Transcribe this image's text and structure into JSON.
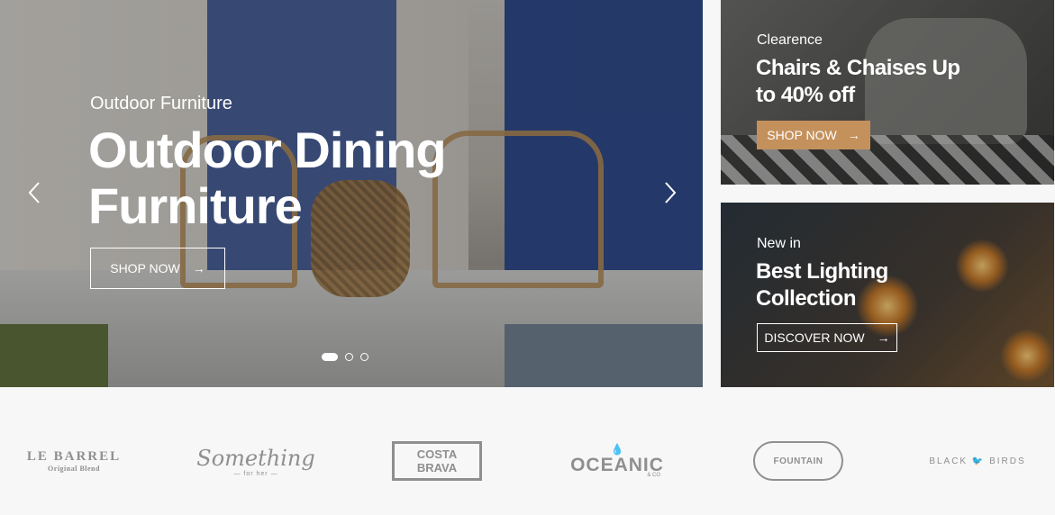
{
  "hero": {
    "subtitle": "Outdoor Furniture",
    "title": "Outdoor Dining Furniture",
    "cta": "SHOP NOW",
    "cta_icon": "arrow-right-icon",
    "prev_icon": "chevron-left-icon",
    "next_icon": "chevron-right-icon",
    "slides_count": 3,
    "active_slide": 1
  },
  "promo1": {
    "kicker": "Clearence",
    "title": "Chairs & Chaises Up to 40% off",
    "cta": "SHOP NOW",
    "cta_color": "#c4915c"
  },
  "promo2": {
    "kicker": "New in",
    "title": "Best Lighting Collection",
    "cta": "DISCOVER NOW"
  },
  "brands": [
    {
      "main": "LE BARREL",
      "sub": "Original Blend"
    },
    {
      "main": "Something",
      "sub": "— for her —"
    },
    {
      "main": "COSTA BRAVA",
      "sub": ""
    },
    {
      "main": "OCEANIC",
      "sub": "& CO"
    },
    {
      "main": "FOUNTAIN",
      "sub": ""
    },
    {
      "main": "BLACK 🐦 BIRDS",
      "sub": ""
    }
  ],
  "colors": {
    "accent": "#c4915c",
    "brand_gray": "#8f8f8f",
    "background": "#f7f7f7"
  }
}
